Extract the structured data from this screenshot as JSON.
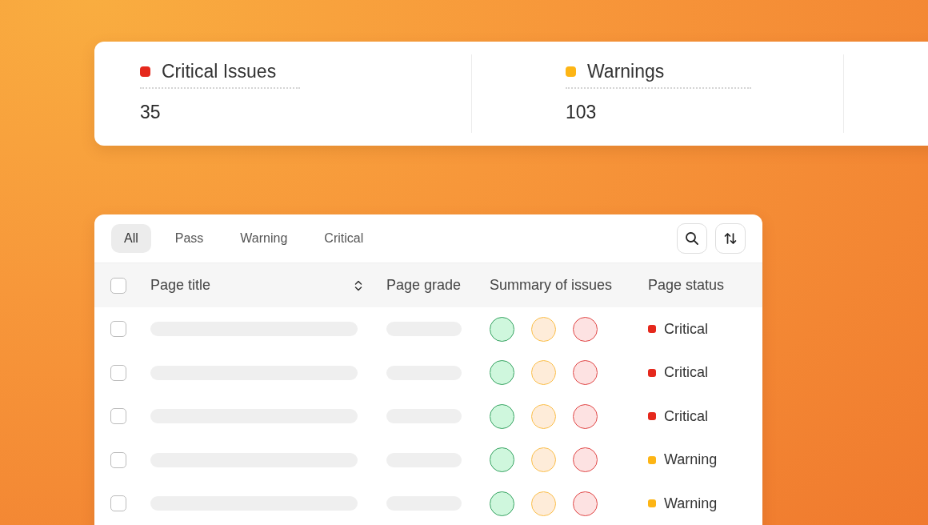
{
  "stats": [
    {
      "label": "Critical Issues",
      "value": "35",
      "color": "#e5281c"
    },
    {
      "label": "Warnings",
      "value": "103",
      "color": "#fdb515"
    }
  ],
  "filters": [
    {
      "label": "All",
      "selected": true
    },
    {
      "label": "Pass",
      "selected": false
    },
    {
      "label": "Warning",
      "selected": false
    },
    {
      "label": "Critical",
      "selected": false
    }
  ],
  "table": {
    "select_all_checked": false,
    "columns": [
      "Page title",
      "Page grade",
      "Summary of issues",
      "Page status"
    ],
    "rows": [
      {
        "checked": false,
        "status": "Critical",
        "color": "#e5281c"
      },
      {
        "checked": false,
        "status": "Critical",
        "color": "#e5281c"
      },
      {
        "checked": false,
        "status": "Critical",
        "color": "#e5281c"
      },
      {
        "checked": false,
        "status": "Warning",
        "color": "#fdb515"
      },
      {
        "checked": false,
        "status": "Warning",
        "color": "#fdb515"
      }
    ]
  }
}
